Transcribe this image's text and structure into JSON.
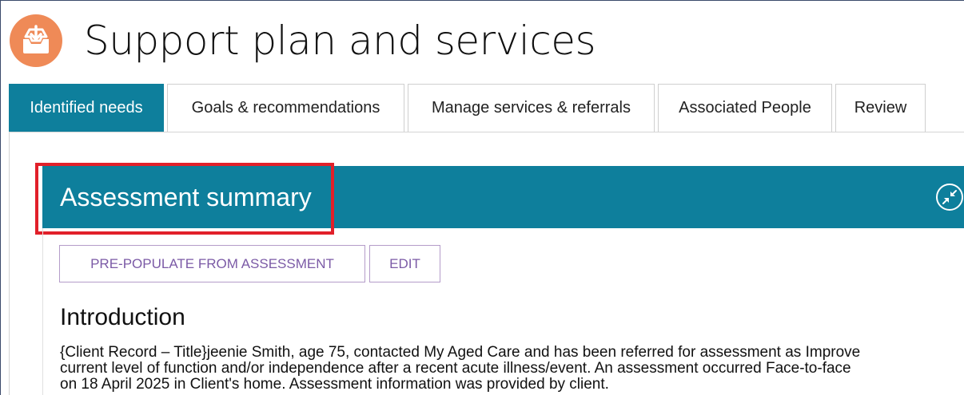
{
  "page": {
    "title": "Support plan and services",
    "icon": "download-tray-icon",
    "accent_color": "#0e7f9c",
    "icon_color": "#ef8a57"
  },
  "tabs": [
    {
      "label": "Identified needs",
      "active": true
    },
    {
      "label": "Goals & recommendations",
      "active": false
    },
    {
      "label": "Manage services & referrals",
      "active": false
    },
    {
      "label": "Associated People",
      "active": false
    },
    {
      "label": "Review",
      "active": false
    }
  ],
  "section": {
    "title": "Assessment summary",
    "collapse_icon": "collapse-arrows-icon",
    "highlight_color": "#e1202a"
  },
  "actions": {
    "prepopulate_label": "PRE-POPULATE FROM ASSESSMENT",
    "edit_label": "EDIT"
  },
  "introduction": {
    "heading": "Introduction",
    "lines": [
      "{Client Record – Title}jeenie Smith, age 75, contacted My Aged Care and has been referred for assessment as Improve",
      "current level of function and/or independence after a recent acute illness/event. An assessment occurred Face-to-face",
      "on 18 April 2025 in Client's home. Assessment information was provided by client."
    ]
  }
}
